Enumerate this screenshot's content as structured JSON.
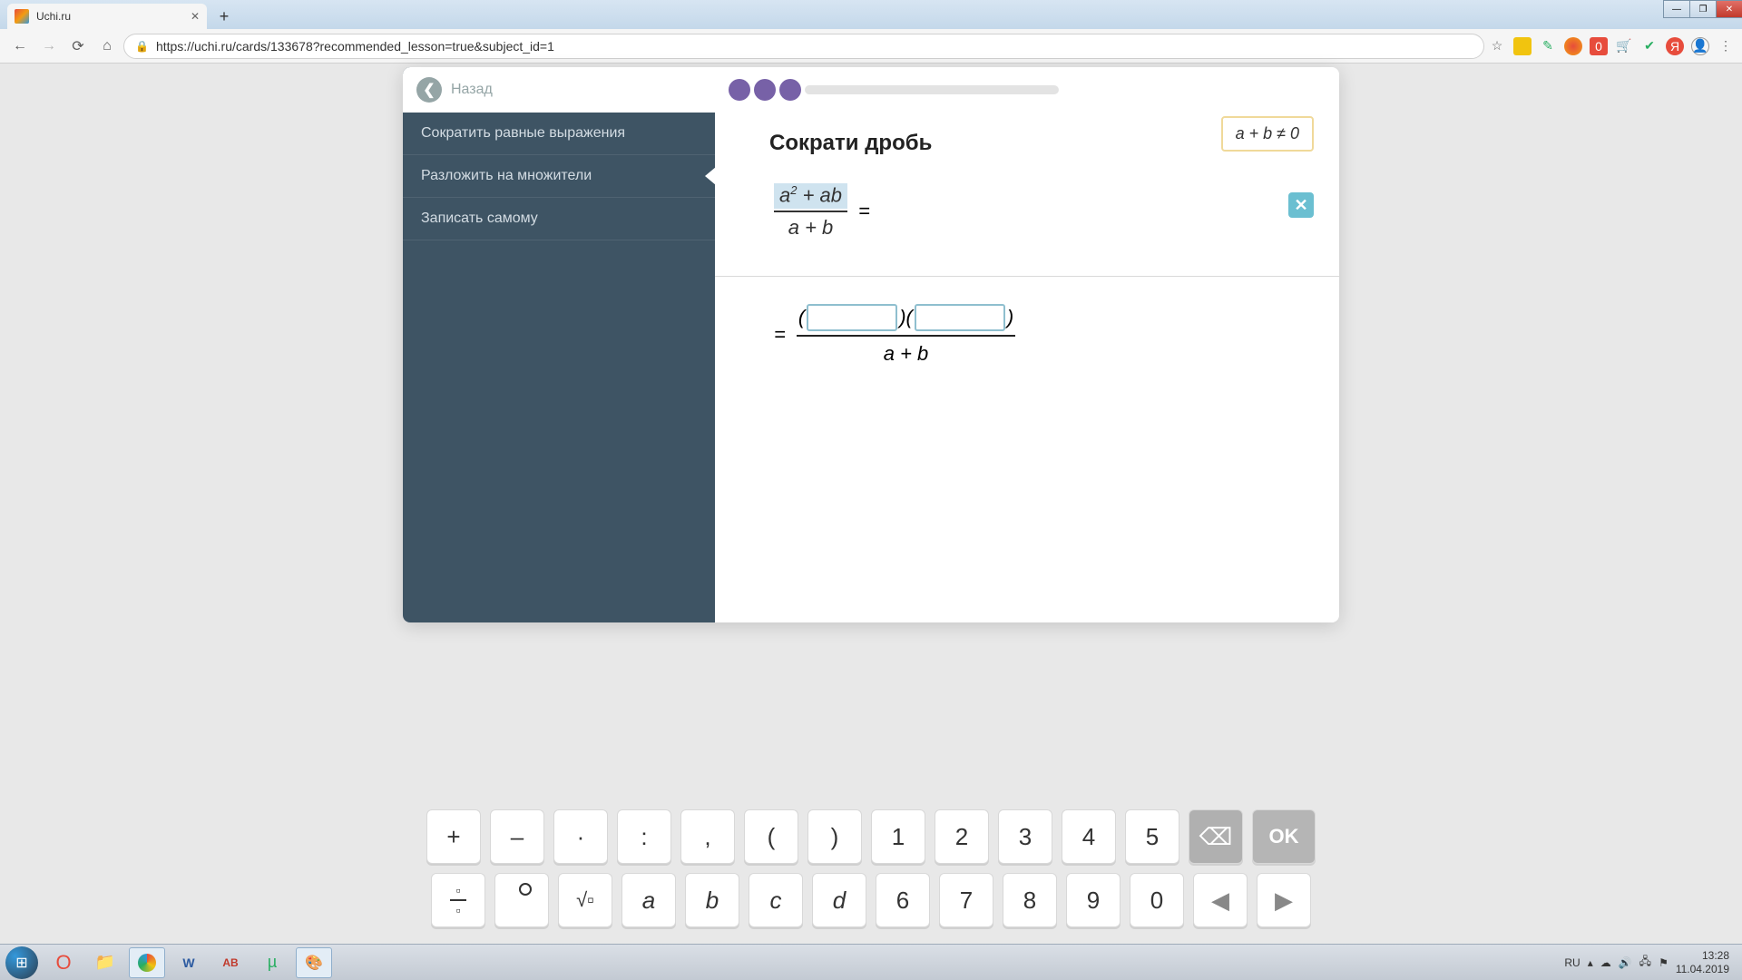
{
  "browser": {
    "tab_title": "Uchi.ru",
    "url": "https://uchi.ru/cards/133678?recommended_lesson=true&subject_id=1"
  },
  "sidebar": {
    "back_label": "Назад",
    "items": [
      {
        "label": "Сократить равные выражения"
      },
      {
        "label": "Разложить на множители"
      },
      {
        "label": "Записать самому"
      }
    ]
  },
  "task": {
    "title": "Сократи дробь",
    "constraint": "a + b ≠ 0",
    "numerator": "a² + ab",
    "denominator": "a + b",
    "work_denominator": "a + b",
    "equals": "="
  },
  "keypad": {
    "row1": [
      "+",
      "–",
      "·",
      ":",
      ",",
      "(",
      ")",
      "1",
      "2",
      "3",
      "4",
      "5"
    ],
    "backspace": "⌫",
    "ok": "OK",
    "row2_special": [
      "frac",
      "deg",
      "sqrt"
    ],
    "row2_vars": [
      "a",
      "b",
      "c",
      "d"
    ],
    "row2_nums": [
      "6",
      "7",
      "8",
      "9",
      "0"
    ],
    "prev": "◀",
    "next": "▶"
  },
  "system": {
    "lang": "RU",
    "time": "13:28",
    "date": "11.04.2019"
  }
}
